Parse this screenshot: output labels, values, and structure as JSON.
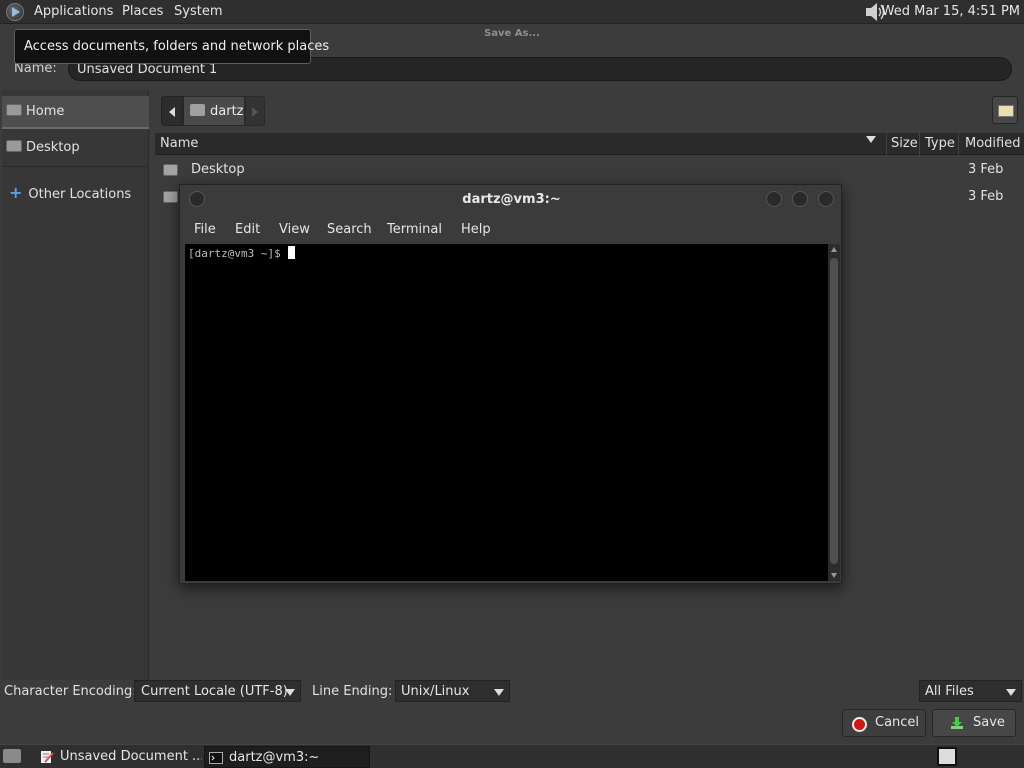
{
  "top_panel": {
    "applications": "Applications",
    "places": "Places",
    "system": "System",
    "clock": "Wed Mar 15,  4:51 PM"
  },
  "dialog": {
    "title": "Save As...",
    "tooltip": "Access documents, folders and network places",
    "name_label": "Name:",
    "name_value": "Unsaved Document 1",
    "sidebar": {
      "home": "Home",
      "desktop": "Desktop",
      "other_locations": "Other Locations"
    },
    "path": {
      "current": "dartz"
    },
    "columns": {
      "name": "Name",
      "size": "Size",
      "type": "Type",
      "modified": "Modified"
    },
    "files": [
      {
        "name": "Desktop",
        "modified": "3 Feb"
      },
      {
        "name": "",
        "modified": "3 Feb"
      }
    ],
    "encoding_label": "Character Encoding:",
    "encoding_value": "Current Locale (UTF-8)",
    "line_ending_label": "Line Ending:",
    "line_ending_value": "Unix/Linux",
    "filter_value": "All Files",
    "cancel": "Cancel",
    "save": "Save"
  },
  "terminal": {
    "title": "dartz@vm3:~",
    "menu": [
      "File",
      "Edit",
      "View",
      "Search",
      "Terminal",
      "Help"
    ],
    "prompt": "[dartz@vm3 ~]$ "
  },
  "taskbar": {
    "task_gedit": "Unsaved Document ...",
    "task_terminal": "dartz@vm3:~"
  },
  "colors": {
    "panel_bg": "#2f2f2f",
    "dialog_bg": "#3c3c3c",
    "terminal_bg": "#000000",
    "cancel_red": "#d01818",
    "accent_blue": "#5aa0e8"
  },
  "icons": [
    "app-menu-logo-icon",
    "volume-icon",
    "home-folder-icon",
    "desktop-folder-icon",
    "plus-icon",
    "back-arrow-icon",
    "forward-arrow-icon",
    "new-folder-icon",
    "folder-icon",
    "cancel-icon",
    "save-icon",
    "show-desktop-icon",
    "text-editor-icon",
    "terminal-icon",
    "workspace-icon"
  ]
}
